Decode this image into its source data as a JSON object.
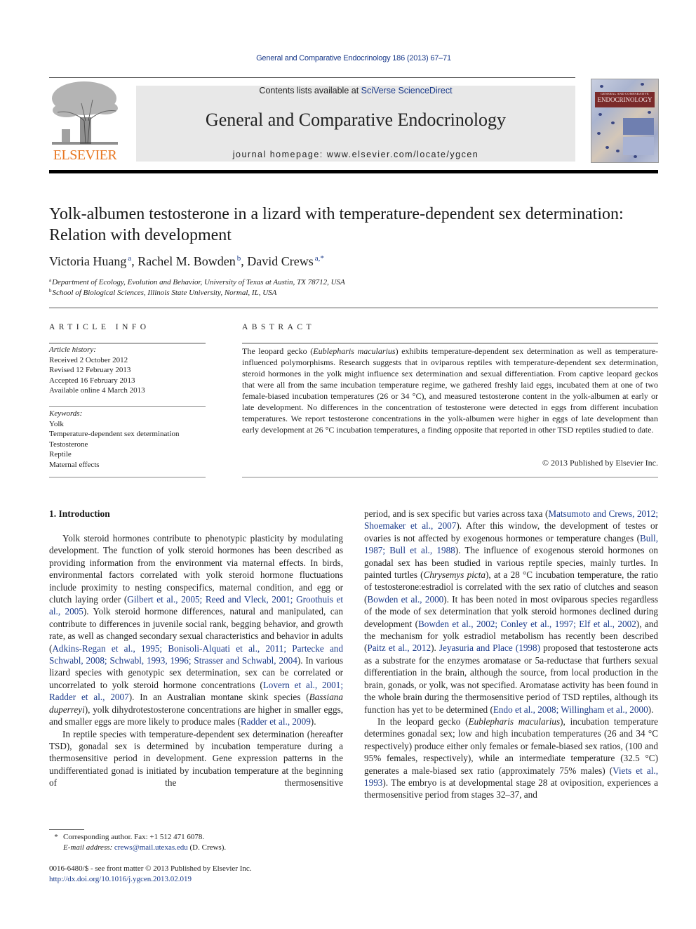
{
  "header": {
    "journal_ref": "General and Comparative Endocrinology 186 (2013) 67–71",
    "contents_prefix": "Contents lists available at ",
    "contents_link": "SciVerse ScienceDirect",
    "journal_title": "General and Comparative Endocrinology",
    "homepage": "journal homepage: www.elsevier.com/locate/ygcen",
    "publisher_logo": "ELSEVIER",
    "cover_title_small": "GENERAL AND COMPARATIVE",
    "cover_title": "ENDOCRINOLOGY",
    "colors": {
      "link": "#1a3a8a",
      "elsevier_orange": "#e87722",
      "banner_bg": "#e8e8e8"
    }
  },
  "article": {
    "title": "Yolk-albumen testosterone in a lizard with temperature-dependent sex determination: Relation with development",
    "authors": [
      {
        "name": "Victoria Huang",
        "sup": "a"
      },
      {
        "name": "Rachel M. Bowden",
        "sup": "b"
      },
      {
        "name": "David Crews",
        "sup": "a,*"
      }
    ],
    "affiliations": [
      {
        "sup": "a",
        "text": "Department of Ecology, Evolution and Behavior, University of Texas at Austin, TX 78712, USA"
      },
      {
        "sup": "b",
        "text": "School of Biological Sciences, Illinois State University, Normal, IL, USA"
      }
    ]
  },
  "article_info": {
    "heading": "ARTICLE INFO",
    "history_label": "Article history:",
    "history": [
      "Received 2 October 2012",
      "Revised 12 February 2013",
      "Accepted 16 February 2013",
      "Available online 4 March 2013"
    ],
    "keywords_label": "Keywords:",
    "keywords": [
      "Yolk",
      "Temperature-dependent sex determination",
      "Testosterone",
      "Reptile",
      "Maternal effects"
    ]
  },
  "abstract": {
    "heading": "ABSTRACT",
    "text_1": "The leopard gecko (",
    "species": "Eublepharis macularius",
    "text_2": ") exhibits temperature-dependent sex determination as well as temperature-influenced polymorphisms. Research suggests that in oviparous reptiles with temperature-dependent sex determination, steroid hormones in the yolk might influence sex determination and sexual differentiation. From captive leopard geckos that were all from the same incubation temperature regime, we gathered freshly laid eggs, incubated them at one of two female-biased incubation temperatures (26 or 34 °C), and measured testosterone content in the yolk-albumen at early or late development. No differences in the concentration of testosterone were detected in eggs from different incubation temperatures. We report testosterone concentrations in the yolk-albumen were higher in eggs of late development than early development at 26 °C incubation temperatures, a finding opposite that reported in other TSD reptiles studied to date.",
    "copyright": "© 2013 Published by Elsevier Inc."
  },
  "intro": {
    "heading": "1. Introduction",
    "p1": [
      {
        "t": "Yolk steroid hormones contribute to phenotypic plasticity by modulating development. The function of yolk steroid hormones has been described as providing information from the environment via maternal effects. In birds, environmental factors correlated with yolk steroid hormone fluctuations include proximity to nesting conspecifics, maternal condition, and egg or clutch laying order ("
      },
      {
        "l": "Gilbert et al., 2005; Reed and Vleck, 2001; Groothuis et al., 2005"
      },
      {
        "t": "). Yolk steroid hormone differences, natural and manipulated, can contribute to differences in juvenile social rank, begging behavior, and growth rate, as well as changed secondary sexual characteristics and behavior in adults ("
      },
      {
        "l": "Adkins-Regan et al., 1995; Bonisoli-Alquati et al., 2011; Partecke and Schwabl, 2008; Schwabl, 1993, 1996; Strasser and Schwabl, 2004"
      },
      {
        "t": "). In various lizard species with genotypic sex determination, sex can be correlated or uncorrelated to yolk steroid hormone concentrations ("
      },
      {
        "l": "Lovern et al., 2001; Radder et al., 2007"
      },
      {
        "t": "). In an Australian montane skink species ("
      },
      {
        "i": "Bassiana duperreyi"
      },
      {
        "t": "), yolk dihydrotestosterone concentrations are higher in smaller eggs, and smaller eggs are more likely to produce males ("
      },
      {
        "l": "Radder et al., 2009"
      },
      {
        "t": ")."
      }
    ],
    "p2": [
      {
        "t": "In reptile species with temperature-dependent sex determination (hereafter TSD), gonadal sex is determined by incubation temperature during a thermosensitive period in development. Gene expression patterns in the undifferentiated gonad is initiated by incubation temperature at the beginning of the thermosensitive period, and is sex specific but varies across taxa ("
      },
      {
        "l": "Matsumoto and Crews, 2012; Shoemaker et al., 2007"
      },
      {
        "t": "). After this window, the development of testes or ovaries is not affected by exogenous hormones or temperature changes ("
      },
      {
        "l": "Bull, 1987; Bull et al., 1988"
      },
      {
        "t": "). The influence of exogenous steroid hormones on gonadal sex has been studied in various reptile species, mainly turtles. In painted turtles ("
      },
      {
        "i": "Chrysemys picta"
      },
      {
        "t": "), at a 28 °C incubation temperature, the ratio of testosterone:estradiol is correlated with the sex ratio of clutches and season ("
      },
      {
        "l": "Bowden et al., 2000"
      },
      {
        "t": "). It has been noted in most oviparous species regardless of the mode of sex determination that yolk steroid hormones declined during development ("
      },
      {
        "l": "Bowden et al., 2002; Conley et al., 1997; Elf et al., 2002"
      },
      {
        "t": "), and the mechanism for yolk estradiol metabolism has recently been described ("
      },
      {
        "l": "Paitz et al., 2012"
      },
      {
        "t": "). "
      },
      {
        "l": "Jeyasuria and Place (1998)"
      },
      {
        "t": " proposed that testosterone acts as a substrate for the enzymes aromatase or 5a-reductase that furthers sexual differentiation in the brain, although the source, from local production in the brain, gonads, or yolk, was not specified. Aromatase activity has been found in the whole brain during the thermosensitive period of TSD reptiles, although its function has yet to be determined ("
      },
      {
        "l": "Endo et al., 2008; Willingham et al., 2000"
      },
      {
        "t": ")."
      }
    ],
    "p3": [
      {
        "t": "In the leopard gecko ("
      },
      {
        "i": "Eublepharis macularius"
      },
      {
        "t": "), incubation temperature determines gonadal sex; low and high incubation temperatures (26 and 34 °C respectively) produce either only females or female-biased sex ratios, (100 and 95% females, respectively), while an intermediate temperature (32.5 °C) generates a male-biased sex ratio (approximately 75% males) ("
      },
      {
        "l": "Viets et al., 1993"
      },
      {
        "t": "). The embryo is at developmental stage 28 at oviposition, experiences a thermosensitive period from stages 32–37, and"
      }
    ]
  },
  "footnotes": {
    "star": "*",
    "corresponding": "Corresponding author. Fax: +1 512 471 6078.",
    "email_label": "E-mail address: ",
    "email": "crews@mail.utexas.edu",
    "email_suffix": " (D. Crews).",
    "issn_line": "0016-6480/$ - see front matter © 2013 Published by Elsevier Inc.",
    "doi": "http://dx.doi.org/10.1016/j.ygcen.2013.02.019"
  }
}
